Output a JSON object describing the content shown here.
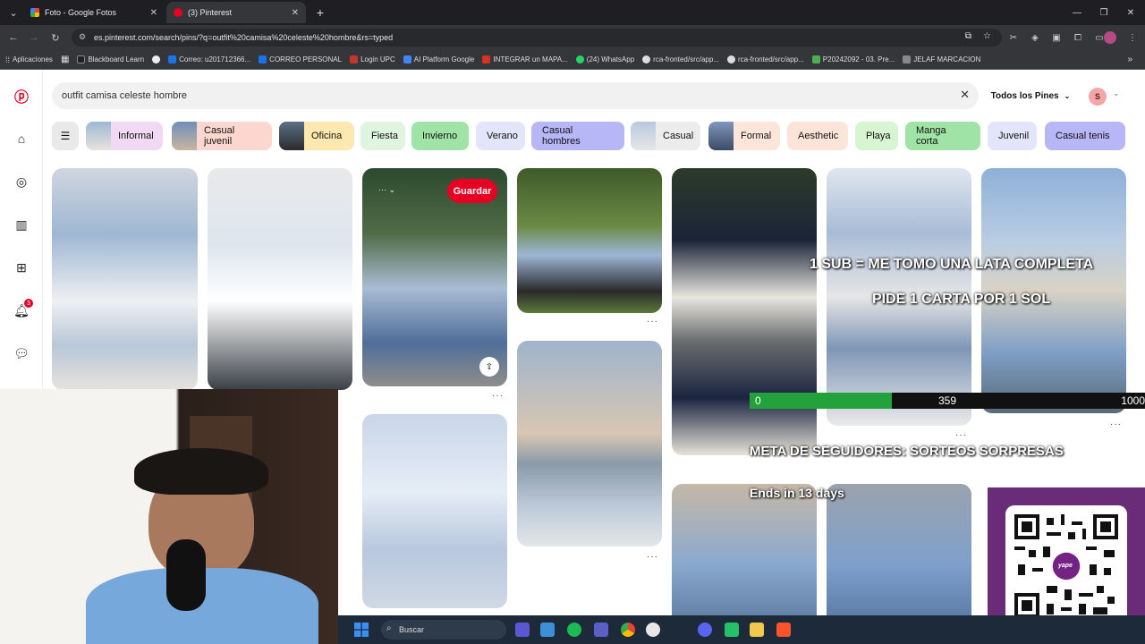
{
  "browser": {
    "tabs": [
      {
        "title": "Foto - Google Fotos",
        "active": false
      },
      {
        "title": "(3) Pinterest",
        "active": true
      }
    ],
    "new_tab": "+",
    "url": "es.pinterest.com/search/pins/?q=outfit%20camisa%20celeste%20hombre&rs=typed",
    "bookmarks": [
      "Aplicaciones",
      "Blackboard Learn",
      "Correo: u201712366...",
      "CORREO PERSONAL",
      "Login UPC",
      "AI Platform Google",
      "INTEGRAR un MAPA...",
      "(24) WhatsApp",
      "rca-fronted/src/app...",
      "rca-fronted/src/app...",
      "P20242092 - 03. Pre...",
      "JELAF MARCACION"
    ],
    "overflow": "»"
  },
  "pinterest": {
    "search_value": "outfit camisa celeste hombre",
    "scope_label": "Todos los Pines",
    "avatar_initial": "S",
    "notification_count": "3",
    "save_label": "Guardar",
    "chips": [
      {
        "label": "Informal",
        "color": "#f1d9f3"
      },
      {
        "label": "Casual juvenil",
        "color": "#fbd7d0"
      },
      {
        "label": "Oficina",
        "color": "#fde9b0"
      },
      {
        "label": "Fiesta",
        "color": "#dff5e0"
      },
      {
        "label": "Invierno",
        "color": "#9fe3a6"
      },
      {
        "label": "Verano",
        "color": "#e3e6fb"
      },
      {
        "label": "Casual hombres",
        "color": "#b7b6f7"
      },
      {
        "label": "Casual",
        "color": "#ececec"
      },
      {
        "label": "Formal",
        "color": "#fde6d9"
      },
      {
        "label": "Aesthetic",
        "color": "#fde4d8"
      },
      {
        "label": "Playa",
        "color": "#d7f5d0"
      },
      {
        "label": "Manga corta",
        "color": "#9fe3a6"
      },
      {
        "label": "Juvenil",
        "color": "#e3e6fb"
      },
      {
        "label": "Casual tenis",
        "color": "#b7b6f7"
      }
    ]
  },
  "overlay": {
    "sub_line1": "1 SUB = ME TOMO UNA LATA COMPLETA",
    "sub_line2": "PIDE 1 CARTA POR 1 SOL",
    "goal_title": "META DE SEGUIDORES: SORTEOS SORPRESAS",
    "goal_min": "0",
    "goal_current": "359",
    "goal_max": "1000",
    "goal_progress": 0.359,
    "goal_ends": "Ends in 13 days",
    "qr_brand": "yape"
  },
  "taskbar": {
    "search_placeholder": "Buscar"
  }
}
